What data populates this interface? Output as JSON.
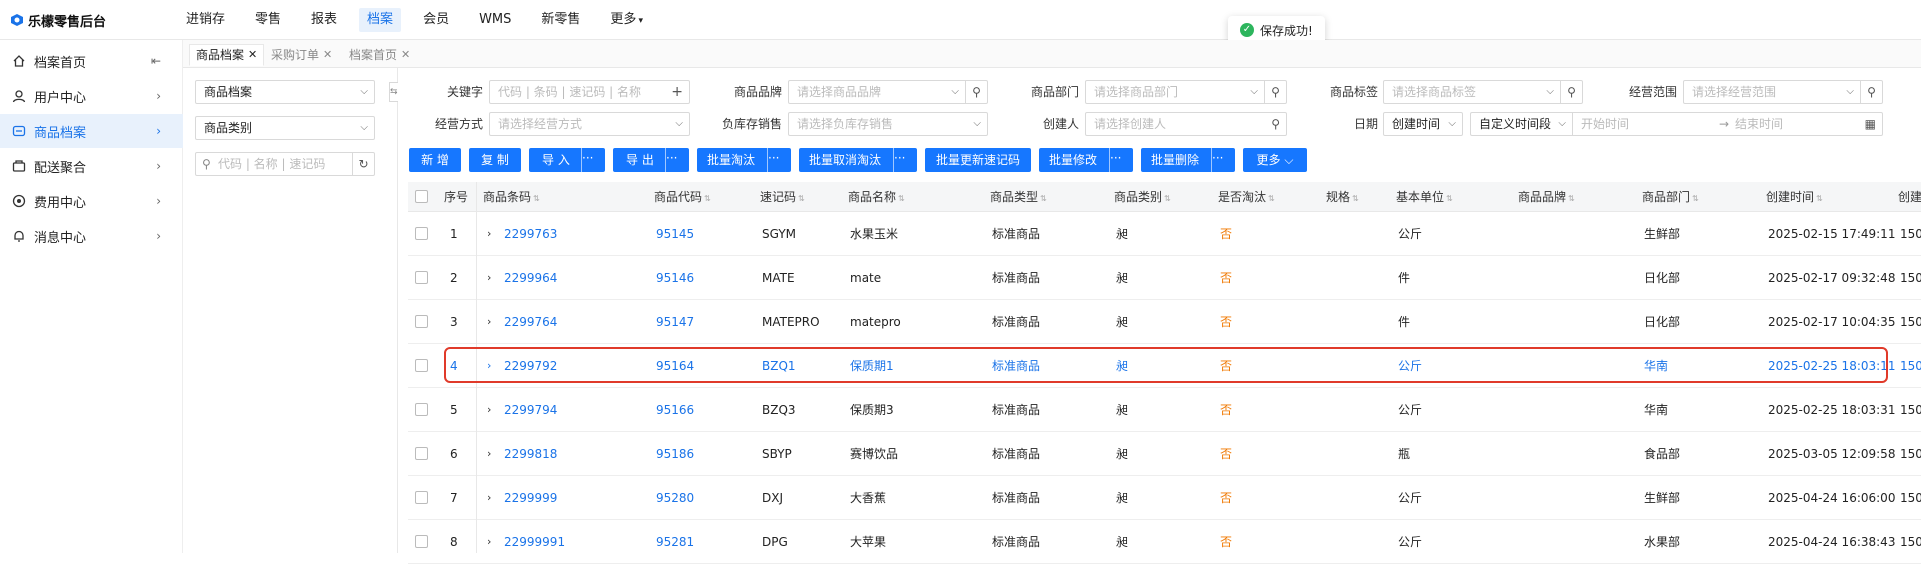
{
  "app": {
    "title": "乐檬零售后台"
  },
  "nav": {
    "items": [
      {
        "label": "进销存"
      },
      {
        "label": "零售"
      },
      {
        "label": "报表"
      },
      {
        "label": "档案",
        "active": true
      },
      {
        "label": "会员"
      },
      {
        "label": "WMS"
      },
      {
        "label": "新零售"
      },
      {
        "label": "更多"
      }
    ]
  },
  "toast": {
    "text": "保存成功!"
  },
  "sidebar": {
    "items": [
      {
        "label": "档案首页",
        "icon": "home-icon"
      },
      {
        "label": "用户中心",
        "icon": "user-icon"
      },
      {
        "label": "商品档案",
        "icon": "product-icon",
        "active": true
      },
      {
        "label": "配送聚合",
        "icon": "delivery-icon"
      },
      {
        "label": "费用中心",
        "icon": "fee-icon"
      },
      {
        "label": "消息中心",
        "icon": "bell-icon"
      }
    ]
  },
  "tabs": [
    {
      "label": "商品档案",
      "active": true
    },
    {
      "label": "采购订单"
    },
    {
      "label": "档案首页"
    }
  ],
  "leftpanel": {
    "select1": "商品档案",
    "select2": "商品类别",
    "search_placeholder": "代码 | 名称 | 速记码"
  },
  "filters": {
    "keyword": {
      "label": "关键字",
      "placeholder": "代码 | 条码 | 速记码 | 名称"
    },
    "brand": {
      "label": "商品品牌",
      "placeholder": "请选择商品品牌"
    },
    "dept": {
      "label": "商品部门",
      "placeholder": "请选择商品部门"
    },
    "tag": {
      "label": "商品标签",
      "placeholder": "请选择商品标签"
    },
    "scope": {
      "label": "经营范围",
      "placeholder": "请选择经营范围"
    },
    "mode": {
      "label": "经营方式",
      "placeholder": "请选择经营方式"
    },
    "negstock": {
      "label": "负库存销售",
      "placeholder": "请选择负库存销售"
    },
    "creator": {
      "label": "创建人",
      "placeholder": "请选择创建人"
    },
    "date": {
      "label": "日期",
      "type_value": "创建时间",
      "range_value": "自定义时间段",
      "start_placeholder": "开始时间",
      "arrow": "→",
      "end_placeholder": "结束时间"
    }
  },
  "toolbar": {
    "new": "新 增",
    "copy": "复 制",
    "import": "导 入",
    "export": "导 出",
    "batch_retire": "批量淘汰",
    "batch_unretire": "批量取消淘汰",
    "batch_update_code": "批量更新速记码",
    "batch_edit": "批量修改",
    "batch_delete": "批量删除",
    "more": "更多",
    "more_dots": "···"
  },
  "table": {
    "headers": {
      "seq": "序号",
      "barcode": "商品条码",
      "code": "商品代码",
      "quick": "速记码",
      "name": "商品名称",
      "type": "商品类型",
      "category": "商品类别",
      "retired": "是否淘汰",
      "spec": "规格",
      "unit": "基本单位",
      "brand": "商品品牌",
      "dept": "商品部门",
      "created": "创建时间",
      "creator": "创建"
    },
    "rows": [
      {
        "seq": "1",
        "barcode": "2299763",
        "code": "95145",
        "quick": "SGYM",
        "name": "水果玉米",
        "type": "标准商品",
        "category": "昶",
        "retired": "否",
        "spec": "",
        "unit": "公斤",
        "brand": "",
        "dept": "生鲜部",
        "created": "2025-02-15 17:49:11",
        "creator": "150"
      },
      {
        "seq": "2",
        "barcode": "2299964",
        "code": "95146",
        "quick": "MATE",
        "name": "mate",
        "type": "标准商品",
        "category": "昶",
        "retired": "否",
        "spec": "",
        "unit": "件",
        "brand": "",
        "dept": "日化部",
        "created": "2025-02-17 09:32:48",
        "creator": "150"
      },
      {
        "seq": "3",
        "barcode": "2299764",
        "code": "95147",
        "quick": "MATEPRO",
        "name": "matepro",
        "type": "标准商品",
        "category": "昶",
        "retired": "否",
        "spec": "",
        "unit": "件",
        "brand": "",
        "dept": "日化部",
        "created": "2025-02-17 10:04:35",
        "creator": "150"
      },
      {
        "seq": "4",
        "barcode": "2299792",
        "code": "95164",
        "quick": "BZQ1",
        "name": "保质期1",
        "type": "标准商品",
        "category": "昶",
        "retired": "否",
        "spec": "",
        "unit": "公斤",
        "brand": "",
        "dept": "华南",
        "created": "2025-02-25 18:03:11",
        "creator": "150"
      },
      {
        "seq": "5",
        "barcode": "2299794",
        "code": "95166",
        "quick": "BZQ3",
        "name": "保质期3",
        "type": "标准商品",
        "category": "昶",
        "retired": "否",
        "spec": "",
        "unit": "公斤",
        "brand": "",
        "dept": "华南",
        "created": "2025-02-25 18:03:31",
        "creator": "150"
      },
      {
        "seq": "6",
        "barcode": "2299818",
        "code": "95186",
        "quick": "SBYP",
        "name": "赛博饮品",
        "type": "标准商品",
        "category": "昶",
        "retired": "否",
        "spec": "",
        "unit": "瓶",
        "brand": "",
        "dept": "食品部",
        "created": "2025-03-05 12:09:58",
        "creator": "150"
      },
      {
        "seq": "7",
        "barcode": "2299999",
        "code": "95280",
        "quick": "DXJ",
        "name": "大香蕉",
        "type": "标准商品",
        "category": "昶",
        "retired": "否",
        "spec": "",
        "unit": "公斤",
        "brand": "",
        "dept": "生鲜部",
        "created": "2025-04-24 16:06:00",
        "creator": "150"
      },
      {
        "seq": "8",
        "barcode": "22999991",
        "code": "95281",
        "quick": "DPG",
        "name": "大苹果",
        "type": "标准商品",
        "category": "昶",
        "retired": "否",
        "spec": "",
        "unit": "公斤",
        "brand": "",
        "dept": "水果部",
        "created": "2025-04-24 16:38:43",
        "creator": "150"
      }
    ]
  }
}
